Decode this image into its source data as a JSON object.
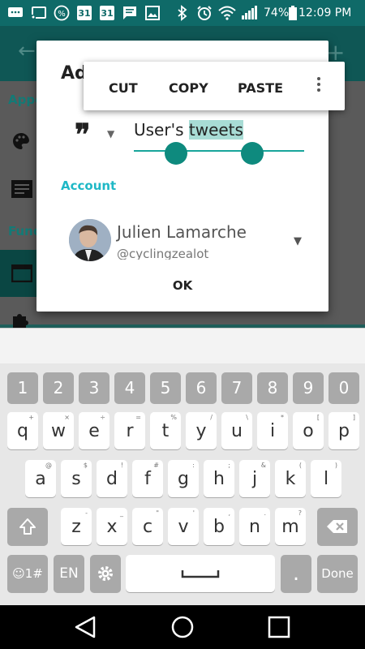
{
  "status_bar": {
    "icons": [
      "message-icon",
      "cast-icon",
      "percent-icon",
      "calendar-icon",
      "calendar-icon",
      "chat-icon",
      "image-icon",
      "bluetooth-icon",
      "alarm-icon",
      "wifi-icon",
      "signal-icon",
      "battery-icon"
    ],
    "calendar_day_1": "31",
    "calendar_day_2": "31",
    "battery": "74%",
    "time": "12:09 PM"
  },
  "background": {
    "section_1": "Appe",
    "section_2": "Func"
  },
  "dialog": {
    "title": "Ad",
    "source_prefix": "User's ",
    "source_selected": "tweets",
    "account_label": "Account",
    "account_name": "Julien Lamarche",
    "account_handle": "@cyclingzealot",
    "ok_label": "OK"
  },
  "context_menu": {
    "cut": "CUT",
    "copy": "COPY",
    "paste": "PASTE"
  },
  "keyboard": {
    "number_row": [
      "1",
      "2",
      "3",
      "4",
      "5",
      "6",
      "7",
      "8",
      "9",
      "0"
    ],
    "row1": [
      {
        "k": "q",
        "h": "+"
      },
      {
        "k": "w",
        "h": "×"
      },
      {
        "k": "e",
        "h": "÷"
      },
      {
        "k": "r",
        "h": "="
      },
      {
        "k": "t",
        "h": "%"
      },
      {
        "k": "y",
        "h": "/"
      },
      {
        "k": "u",
        "h": "\\"
      },
      {
        "k": "i",
        "h": "*"
      },
      {
        "k": "o",
        "h": "["
      },
      {
        "k": "p",
        "h": "]"
      }
    ],
    "row2": [
      {
        "k": "a",
        "h": "@"
      },
      {
        "k": "s",
        "h": "$"
      },
      {
        "k": "d",
        "h": "!"
      },
      {
        "k": "f",
        "h": "#"
      },
      {
        "k": "g",
        "h": ":"
      },
      {
        "k": "h",
        "h": ";"
      },
      {
        "k": "j",
        "h": "&"
      },
      {
        "k": "k",
        "h": "("
      },
      {
        "k": "l",
        "h": ")"
      }
    ],
    "row3": [
      {
        "k": "z",
        "h": "-"
      },
      {
        "k": "x",
        "h": "_"
      },
      {
        "k": "c",
        "h": "\""
      },
      {
        "k": "v",
        "h": "'"
      },
      {
        "k": "b",
        "h": ","
      },
      {
        "k": "n",
        "h": "."
      },
      {
        "k": "m",
        "h": "?"
      }
    ],
    "emoji_label": "☺1#",
    "lang_label": "EN",
    "period_label": ".",
    "done_label": "Done"
  },
  "colors": {
    "accent": "#18a59b",
    "account_label": "#1fb8c6",
    "app_bar": "#0f6a68"
  }
}
